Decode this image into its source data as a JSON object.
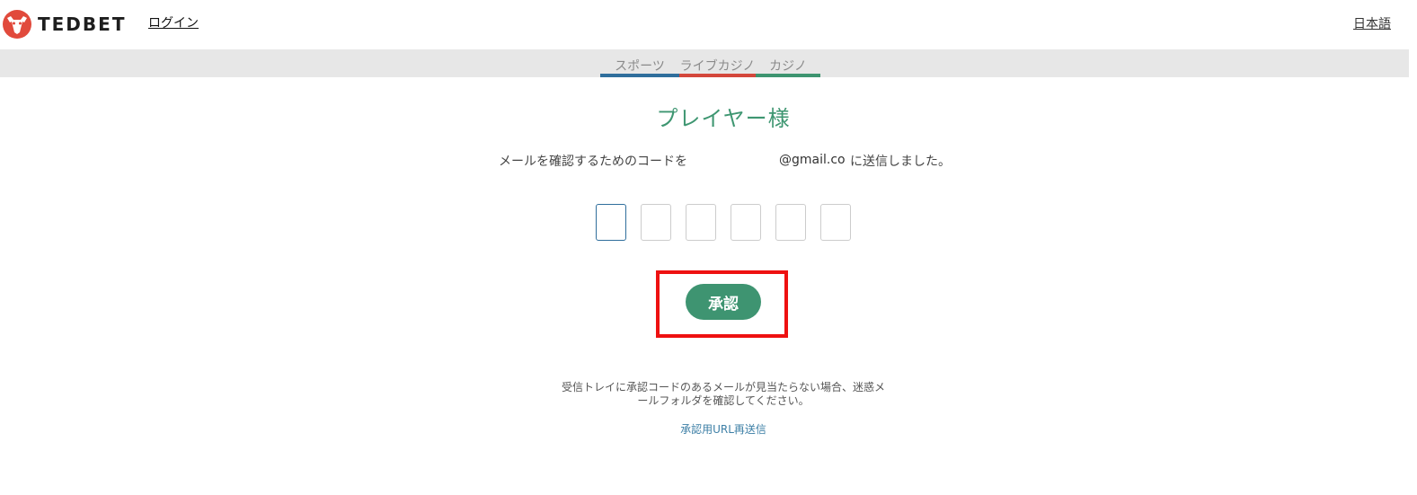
{
  "header": {
    "brand": "TEDBET",
    "login_label": "ログイン",
    "language_label": "日本語"
  },
  "tabs": [
    {
      "label": "スポーツ",
      "color": "#2f6e9c"
    },
    {
      "label": "ライブカジノ",
      "color": "#d4473b"
    },
    {
      "label": "カジノ",
      "color": "#3d9470"
    }
  ],
  "verification": {
    "title": "プレイヤー様",
    "message_prefix": "メールを確認するためのコードを",
    "email": "@gmail.con",
    "message_suffix": "に送信しました。",
    "code_digits": [
      "",
      "",
      "",
      "",
      "",
      ""
    ],
    "approve_label": "承認",
    "help_text": "受信トレイに承認コードのあるメールが見当たらない場合、迷惑メールフォルダを確認してください。",
    "resend_label": "承認用URL再送信"
  },
  "colors": {
    "accent": "#3e9471",
    "logo_red": "#e14a3c",
    "highlight": "#ee1111",
    "link": "#3d7fa6"
  },
  "icons": {
    "logo": "bull-head-icon"
  }
}
